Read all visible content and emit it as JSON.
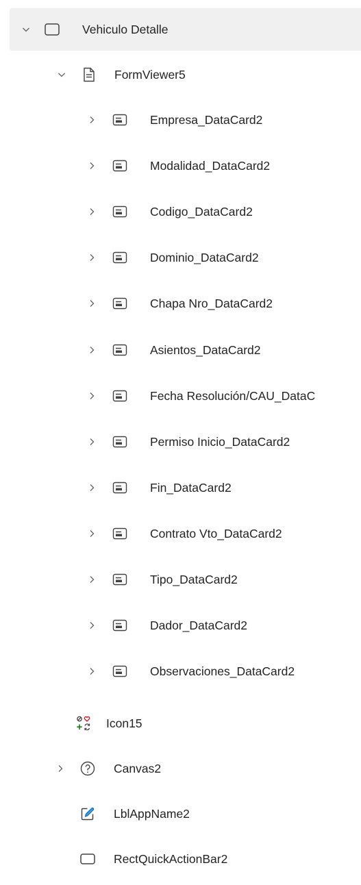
{
  "tree": {
    "root": {
      "label": "Vehiculo Detalle",
      "expanded": true,
      "icon": "screen-icon"
    },
    "form": {
      "label": "FormViewer5",
      "expanded": true,
      "icon": "form-icon"
    },
    "cards": [
      "Empresa_DataCard2",
      "Modalidad_DataCard2",
      "Codigo_DataCard2",
      "Dominio_DataCard2",
      "Chapa Nro_DataCard2",
      "Asientos_DataCard2",
      "Fecha Resolución/CAU_DataC",
      "Permiso Inicio_DataCard2",
      "Fin_DataCard2",
      "Contrato Vto_DataCard2",
      "Tipo_DataCard2",
      "Dador_DataCard2",
      "Observaciones_DataCard2"
    ],
    "icon15": {
      "label": "Icon15",
      "icon": "icons-control-icon"
    },
    "canvas": {
      "label": "Canvas2",
      "expanded": false,
      "icon": "canvas-icon"
    },
    "lblapp": {
      "label": "LblAppName2",
      "icon": "label-edit-icon"
    },
    "rect": {
      "label": "RectQuickActionBar2",
      "icon": "rectangle-icon"
    }
  },
  "colors": {
    "selected_bg": "#f0f0f0",
    "text": "#242424",
    "icon_green": "#107c10",
    "icon_red": "#c50f1f",
    "pencil_blue": "#1976d2"
  }
}
